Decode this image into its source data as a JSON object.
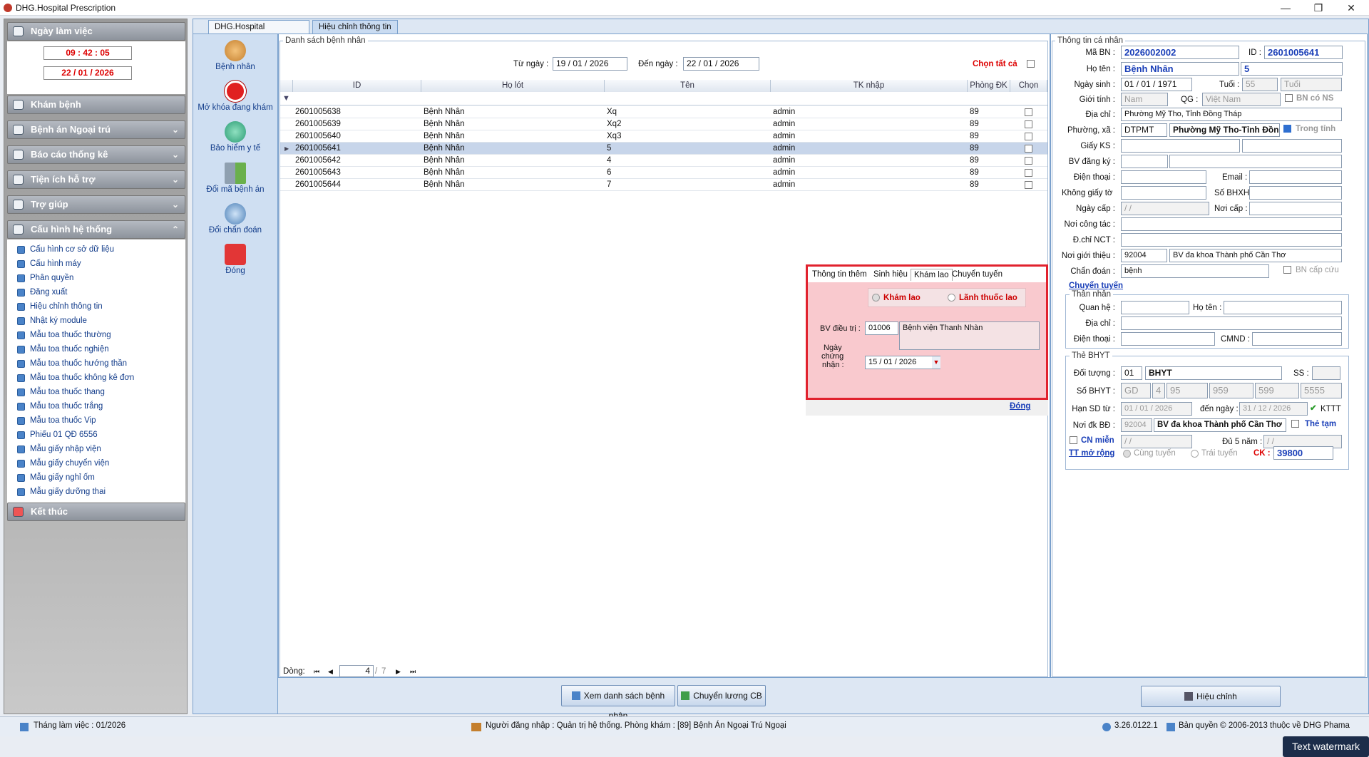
{
  "window": {
    "title": "DHG.Hospital Prescription",
    "min": "—",
    "max": "❐",
    "close": "✕"
  },
  "sidebar": {
    "workday_label": "Ngày làm việc",
    "time": "09 : 42 : 05",
    "date": "22 / 01 / 2026",
    "sections": [
      "Khám bệnh",
      "Bệnh án Ngoại trú",
      "Báo cáo thống kê",
      "Tiện ích hỗ trợ",
      "Trợ giúp",
      "Cấu hình hệ thống"
    ],
    "config_items": [
      "Cấu hình cơ sở dữ liệu",
      "Cấu hình máy",
      "Phân quyền",
      "Đăng xuất",
      "Hiệu chỉnh thông tin",
      "Nhật ký module",
      "Mẫu toa thuốc thường",
      "Mẫu toa thuốc nghiện",
      "Mẫu toa thuốc hướng thần",
      "Mẫu toa thuốc không kê đơn",
      "Mẫu toa thuốc thang",
      "Mẫu toa thuốc trắng",
      "Mẫu toa thuốc Vip",
      "Phiếu 01 QĐ 6556",
      "Mẫu giấy nhập viện",
      "Mẫu giấy chuyển viện",
      "Mẫu giấy nghỉ ốm",
      "Mẫu giấy dưỡng thai"
    ],
    "exit_label": "Kết thúc"
  },
  "tabs": [
    "DHG.Hospital Prescription",
    "Hiệu chỉnh thông tin"
  ],
  "toolbar": [
    "Bệnh nhân",
    "Mở khóa đang khám",
    "Bảo hiểm y tế",
    "Đổi mã bệnh án",
    "Đổi chẩn đoán",
    "Đóng"
  ],
  "list": {
    "group_label": "Danh sách bệnh nhân",
    "from_label": "Từ ngày :",
    "from_date": "19 / 01 / 2026",
    "to_label": "Đến ngày :",
    "to_date": "22 / 01 / 2026",
    "select_all": "Chọn tất cả",
    "columns": [
      "ID",
      "Họ lót",
      "Tên",
      "TK nhập",
      "Phòng ĐK",
      "Chọn"
    ],
    "rows": [
      [
        "2601005638",
        "Bệnh Nhân",
        "Xq",
        "admin",
        "89"
      ],
      [
        "2601005639",
        "Bệnh Nhân",
        "Xq2",
        "admin",
        "89"
      ],
      [
        "2601005640",
        "Bệnh Nhân",
        "Xq3",
        "admin",
        "89"
      ],
      [
        "2601005641",
        "Bệnh Nhân",
        "5",
        "admin",
        "89"
      ],
      [
        "2601005642",
        "Bệnh Nhân",
        "4",
        "admin",
        "89"
      ],
      [
        "2601005643",
        "Bệnh Nhân",
        "6",
        "admin",
        "89"
      ],
      [
        "2601005644",
        "Bệnh Nhân",
        "7",
        "admin",
        "89"
      ]
    ],
    "selected_row": 3,
    "pager": {
      "label": "Dòng:",
      "current": "4",
      "total": "7",
      "first": "⏮",
      "prev": "◀",
      "next": "▶",
      "last": "⏭"
    }
  },
  "popup": {
    "tabs": [
      "Thông tin thêm",
      "Sinh hiệu",
      "Khám lao",
      "Chuyển tuyến"
    ],
    "radio1": "Khám lao",
    "radio2": "Lãnh thuốc lao",
    "bv_label": "BV điều trị :",
    "bv_code": "01006",
    "bv_name": "Bệnh viện Thanh Nhàn",
    "cert_label1": "Ngày",
    "cert_label2": "chứng",
    "cert_label3": "nhận :",
    "cert_date": "15 / 01 / 2026",
    "close": "Đóng"
  },
  "buttons": {
    "view_list": "Xem danh sách bệnh nhân",
    "transfer": "Chuyển lương CB",
    "edit": "Hiệu chỉnh"
  },
  "personal": {
    "group": "Thông tin cá nhân",
    "ma_bn_label": "Mã BN :",
    "ma_bn": "2026002002",
    "id_label": "ID :",
    "id": "2601005641",
    "ho_ten_label": "Họ tên :",
    "ho": "Bệnh Nhân",
    "ten": "5",
    "ngay_sinh_label": "Ngày sinh :",
    "ngay_sinh": "01 / 01 / 1971",
    "tuoi_label": "Tuổi :",
    "tuoi": "55",
    "tuoi_unit": "Tuổi",
    "gioi_tinh_label": "Giới tính :",
    "gioi_tinh": "Nam",
    "qg_label": "QG :",
    "qg": "Việt Nam",
    "bn_co_ns": "BN có NS",
    "dia_chi_label": "Địa chỉ :",
    "dia_chi": "Phường Mỹ Tho, Tỉnh Đồng Tháp",
    "phuong_label": "Phường, xã :",
    "phuong_code": "DTPMT",
    "phuong": "Phường Mỹ Tho-Tỉnh Đồng",
    "trong_tinh": "Trong tỉnh",
    "giay_ks_label": "Giấy KS :",
    "bv_dk_label": "BV đăng ký :",
    "dien_thoai_label": "Điện thoại :",
    "email_label": "Email :",
    "khong_giay_to_label": "Không giấy tờ",
    "so_bhxh_label": "Số BHXH :",
    "ngay_cap_label": "Ngày cấp :",
    "ngay_cap": "  /   /",
    "noi_cap_label": "Nơi cấp :",
    "noi_cong_tac_label": "Nơi công tác :",
    "dchi_nct_label": "Đ.chỉ NCT :",
    "noi_gioi_thieu_label": "Nơi giới thiệu :",
    "noi_gt_code": "92004",
    "noi_gt": "BV đa khoa Thành phố Cần Thơ",
    "chan_doan_label": "Chẩn đoán :",
    "chan_doan": "bệnh",
    "bn_cap_cuu": "BN cấp cứu",
    "chuyen_tuyen": "Chuyển tuyến"
  },
  "relative": {
    "group": "Thân nhân",
    "quan_he_label": "Quan hệ :",
    "ho_ten_label": "Họ tên :",
    "dia_chi_label": "Địa chỉ :",
    "dien_thoai_label": "Điện thoại :",
    "cmnd_label": "CMND :"
  },
  "bhyt": {
    "group": "Thẻ BHYT",
    "doi_tuong_label": "Đối tượng :",
    "doi_tuong_code": "01",
    "doi_tuong": "BHYT",
    "ss_label": "SS :",
    "so_label": "Số BHYT :",
    "so": [
      "GD",
      "4",
      "95",
      "959",
      "599",
      "5555"
    ],
    "han_label": "Hạn SD từ :",
    "han_tu": "01 / 01 / 2026",
    "den_label": "đến ngày :",
    "han_den": "31 / 12 / 2026",
    "kttt": "KTTT",
    "noi_dk_label": "Nơi đk BĐ :",
    "noi_dk_code": "92004",
    "noi_dk": "BV đa khoa Thành phố Cần Thơ",
    "the_tam": "Thẻ tạm",
    "cn_mien": "CN miễn",
    "cn_date": "  /   /",
    "du5_label": "Đủ 5 năm :",
    "du5_date": "  /   /",
    "tt_mo_rong": "TT mở rộng",
    "cung_tuyen": "Cùng tuyến",
    "trai_tuyen": "Trái tuyến",
    "ck_label": "CK :",
    "ck": "39800"
  },
  "status": {
    "month": "Tháng làm việc : 01/2026",
    "login": "Người đăng nhập : Quản trị hệ thống. Phòng khám : [89] Bệnh Án Ngoại Trú Ngoại",
    "version": "3.26.0122.1",
    "copyright": "Bản quyền © 2006-2013 thuộc về DHG Phama"
  },
  "watermark": "Text watermark"
}
